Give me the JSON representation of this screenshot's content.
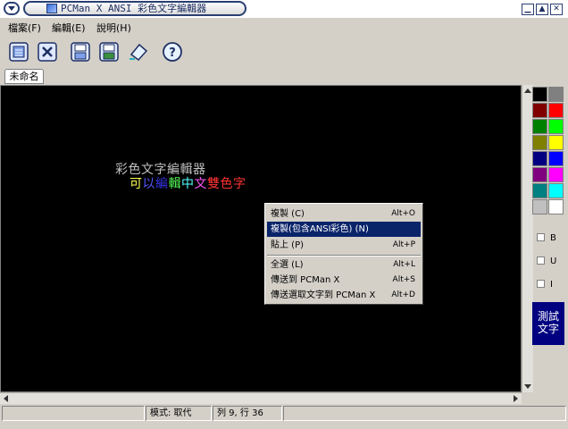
{
  "window": {
    "title": "PCMan X ANSI 彩色文字編輯器"
  },
  "menubar": [
    {
      "label": "檔案(F)"
    },
    {
      "label": "編輯(E)"
    },
    {
      "label": "說明(H)"
    }
  ],
  "toolbar": [
    {
      "icon": "new-file-icon"
    },
    {
      "icon": "close-icon"
    },
    {
      "icon": "save-icon"
    },
    {
      "icon": "save-as-icon"
    },
    {
      "icon": "eraser-icon"
    },
    {
      "icon": "help-icon"
    }
  ],
  "tab": {
    "label": "未命名"
  },
  "editor": {
    "line1": "彩色文字編輯器",
    "line2_chars": [
      {
        "ch": "可",
        "color": "#ffff55"
      },
      {
        "ch": "以",
        "color": "#5555ff"
      },
      {
        "ch": "編",
        "color": "#3333dd"
      },
      {
        "ch": "輯",
        "color": "#55ff55"
      },
      {
        "ch": "中",
        "color": "#55ffff"
      },
      {
        "ch": "文",
        "color": "#ff55ff"
      },
      {
        "ch": "雙",
        "color": "#ff3333"
      },
      {
        "ch": "色",
        "color": "#ff3333"
      },
      {
        "ch": "字",
        "color": "#ff3333"
      }
    ]
  },
  "palette": [
    "#000000",
    "#808080",
    "#800000",
    "#ff0000",
    "#008000",
    "#00ff00",
    "#808000",
    "#ffff00",
    "#000080",
    "#0000ff",
    "#800080",
    "#ff00ff",
    "#008080",
    "#00ffff",
    "#c0c0c0",
    "#ffffff"
  ],
  "style_options": [
    {
      "label": "B",
      "checked": false
    },
    {
      "label": "U",
      "checked": false
    },
    {
      "label": "I",
      "checked": false
    }
  ],
  "test_button": {
    "label": "測試文字"
  },
  "context_menu": {
    "items": [
      {
        "label": "複製 (C)",
        "shortcut": "Alt+O",
        "highlighted": false
      },
      {
        "label": "複製(包含ANSI彩色) (N)",
        "shortcut": "",
        "highlighted": true
      },
      {
        "label": "貼上 (P)",
        "shortcut": "Alt+P",
        "highlighted": false
      },
      {
        "label": "全選 (L)",
        "shortcut": "Alt+L",
        "highlighted": false
      },
      {
        "label": "傳送到 PCMan X",
        "shortcut": "Alt+S",
        "highlighted": false
      },
      {
        "label": "傳送選取文字到 PCMan X",
        "shortcut": "Alt+D",
        "highlighted": false
      }
    ]
  },
  "statusbar": {
    "mode": "模式: 取代",
    "position": "列 9, 行 36"
  }
}
